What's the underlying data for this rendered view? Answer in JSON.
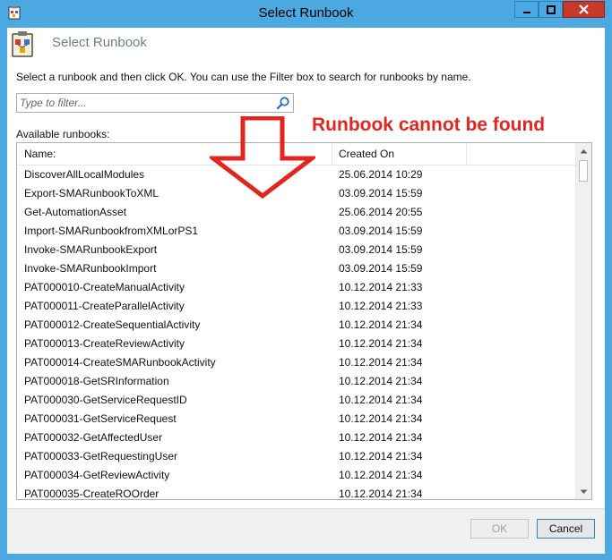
{
  "window": {
    "title": "Select Runbook",
    "header_title": "Select Runbook",
    "instructions": "Select a runbook and then click OK. You can use the Filter box to search for runbooks by name."
  },
  "filter": {
    "placeholder": "Type to filter...",
    "value": ""
  },
  "list": {
    "label": "Available runbooks:",
    "columns": {
      "name": "Name:",
      "created": "Created On"
    },
    "rows": [
      {
        "name": "DiscoverAllLocalModules",
        "created": "25.06.2014 10:29"
      },
      {
        "name": "Export-SMARunbookToXML",
        "created": "03.09.2014 15:59"
      },
      {
        "name": "Get-AutomationAsset",
        "created": "25.06.2014 20:55"
      },
      {
        "name": "Import-SMARunbookfromXMLorPS1",
        "created": "03.09.2014 15:59"
      },
      {
        "name": "Invoke-SMARunbookExport",
        "created": "03.09.2014 15:59"
      },
      {
        "name": "Invoke-SMARunbookImport",
        "created": "03.09.2014 15:59"
      },
      {
        "name": "PAT000010-CreateManualActivity",
        "created": "10.12.2014 21:33"
      },
      {
        "name": "PAT000011-CreateParallelActivity",
        "created": "10.12.2014 21:33"
      },
      {
        "name": "PAT000012-CreateSequentialActivity",
        "created": "10.12.2014 21:34"
      },
      {
        "name": "PAT000013-CreateReviewActivity",
        "created": "10.12.2014 21:34"
      },
      {
        "name": "PAT000014-CreateSMARunbookActivity",
        "created": "10.12.2014 21:34"
      },
      {
        "name": "PAT000018-GetSRInformation",
        "created": "10.12.2014 21:34"
      },
      {
        "name": "PAT000030-GetServiceRequestID",
        "created": "10.12.2014 21:34"
      },
      {
        "name": "PAT000031-GetServiceRequest",
        "created": "10.12.2014 21:34"
      },
      {
        "name": "PAT000032-GetAffectedUser",
        "created": "10.12.2014 21:34"
      },
      {
        "name": "PAT000033-GetRequestingUser",
        "created": "10.12.2014 21:34"
      },
      {
        "name": "PAT000034-GetReviewActivity",
        "created": "10.12.2014 21:34"
      },
      {
        "name": "PAT000035-CreateROOrder",
        "created": "10.12.2014 21:34"
      }
    ]
  },
  "annotation": {
    "text": "Runbook cannot be found",
    "color": "#e0261f"
  },
  "buttons": {
    "ok": "OK",
    "cancel": "Cancel"
  },
  "icons": {
    "title": "runbook-clipboard-icon",
    "header": "runbook-clipboard-icon",
    "search": "search-icon",
    "minimize": "minimize-icon",
    "maximize": "maximize-icon",
    "close": "close-icon"
  },
  "colors": {
    "titlebar": "#4ca8e0",
    "close_button": "#c7392a",
    "annotation": "#e0261f"
  }
}
